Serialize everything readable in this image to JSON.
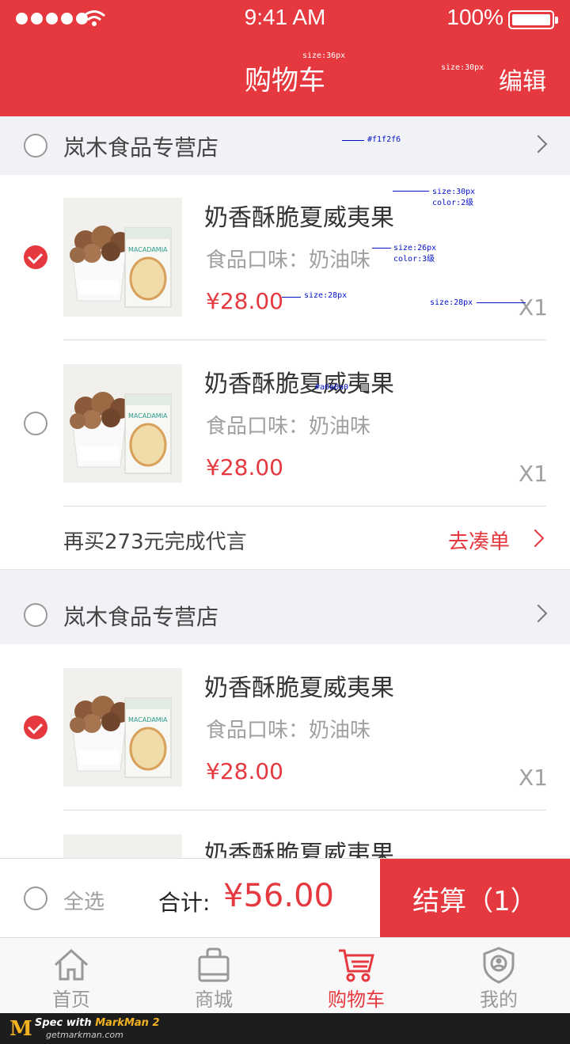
{
  "status_bar": {
    "time": "9:41 AM",
    "battery": "100%"
  },
  "header": {
    "title": "购物车",
    "edit_label": "编辑"
  },
  "annotations": {
    "title_size": "size:36px",
    "edit_size": "size:30px",
    "store_bg": "#f1f2f6",
    "name_size": "size:30px",
    "name_color": "color:2级",
    "flavor_size": "size:26px",
    "flavor_color": "color:3级",
    "price_size": "size:28px",
    "qty_size": "size:28px",
    "gray_color": "#a0a0a0"
  },
  "stores": [
    {
      "name": "岚木食品专营店",
      "checked": false,
      "items": [
        {
          "name": "奶香酥脆夏威夷果",
          "flavor": "食品口味：奶油味",
          "price": "¥28.00",
          "qty": "X1",
          "checked": true,
          "image_brand": "MACADAMIA"
        },
        {
          "name": "奶香酥脆夏威夷果",
          "flavor": "食品口味：奶油味",
          "price": "¥28.00",
          "qty": "X1",
          "checked": false,
          "image_brand": "MACADAMIA"
        }
      ],
      "promo": {
        "text": "再买273元完成代言",
        "link": "去凑单"
      }
    },
    {
      "name": "岚木食品专营店",
      "checked": false,
      "items": [
        {
          "name": "奶香酥脆夏威夷果",
          "flavor": "食品口味：奶油味",
          "price": "¥28.00",
          "qty": "X1",
          "checked": true,
          "image_brand": "MACADAMIA"
        },
        {
          "name": "奶香酥脆夏威夷果"
        }
      ]
    }
  ],
  "checkout": {
    "select_all": "全选",
    "total_label": "合计:",
    "total_value": "¥56.00",
    "button_label": "结算（1）"
  },
  "tabs": [
    {
      "label": "首页",
      "icon": "home-icon",
      "active": false
    },
    {
      "label": "商城",
      "icon": "shopping-bag-icon",
      "active": false
    },
    {
      "label": "购物车",
      "icon": "cart-icon",
      "active": true
    },
    {
      "label": "我的",
      "icon": "profile-shield-icon",
      "active": false
    }
  ],
  "markman": {
    "line1_prefix": "Spec with ",
    "line1_brand": "MarkMan 2",
    "line2": "getmarkman.com"
  },
  "colors": {
    "accent": "#e5393f",
    "store_bg": "#f1f2f6",
    "gray_text": "#a0a0a0"
  }
}
